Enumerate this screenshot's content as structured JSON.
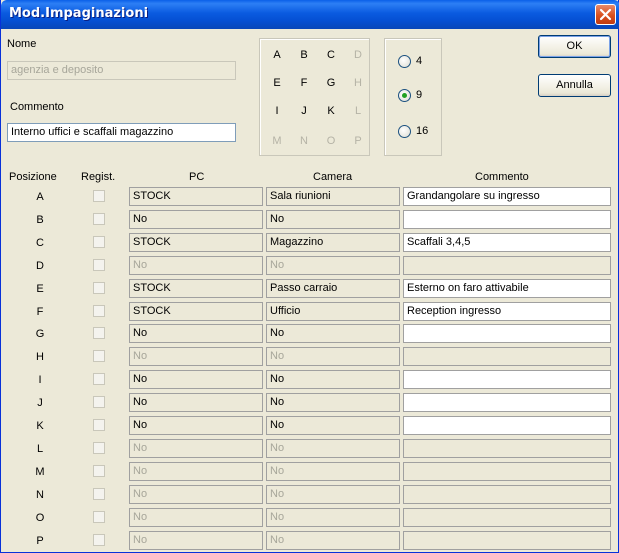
{
  "window": {
    "title": "Mod.Impaginazioni"
  },
  "form": {
    "nome_label": "Nome",
    "nome_value": "agenzia e deposito",
    "commento_label": "Commento",
    "commento_value": "Interno uffici e scaffali magazzino"
  },
  "grid_letters": [
    {
      "l": "A",
      "on": true
    },
    {
      "l": "B",
      "on": true
    },
    {
      "l": "C",
      "on": true
    },
    {
      "l": "D",
      "on": false
    },
    {
      "l": "E",
      "on": true
    },
    {
      "l": "F",
      "on": true
    },
    {
      "l": "G",
      "on": true
    },
    {
      "l": "H",
      "on": false
    },
    {
      "l": "I",
      "on": true
    },
    {
      "l": "J",
      "on": true
    },
    {
      "l": "K",
      "on": true
    },
    {
      "l": "L",
      "on": false
    },
    {
      "l": "M",
      "on": false
    },
    {
      "l": "N",
      "on": false
    },
    {
      "l": "O",
      "on": false
    },
    {
      "l": "P",
      "on": false
    }
  ],
  "layout_options": {
    "opt4": "4",
    "opt9": "9",
    "opt16": "16",
    "selected": "9"
  },
  "buttons": {
    "ok": "OK",
    "annulla": "Annulla"
  },
  "table": {
    "headers": {
      "posizione": "Posizione",
      "regist": "Regist.",
      "pc": "PC",
      "camera": "Camera",
      "commento": "Commento"
    },
    "rows": [
      {
        "pos": "A",
        "pc": "STOCK",
        "camera": "Sala riunioni",
        "comment": "Grandangolare su ingresso",
        "enabled": true
      },
      {
        "pos": "B",
        "pc": "No",
        "camera": "No",
        "comment": "",
        "enabled": true
      },
      {
        "pos": "C",
        "pc": "STOCK",
        "camera": "Magazzino",
        "comment": "Scaffali 3,4,5",
        "enabled": true
      },
      {
        "pos": "D",
        "pc": "No",
        "camera": "No",
        "comment": "",
        "enabled": false
      },
      {
        "pos": "E",
        "pc": "STOCK",
        "camera": "Passo carraio",
        "comment": "Esterno on faro attivabile",
        "enabled": true
      },
      {
        "pos": "F",
        "pc": "STOCK",
        "camera": "Ufficio",
        "comment": "Reception ingresso",
        "enabled": true
      },
      {
        "pos": "G",
        "pc": "No",
        "camera": "No",
        "comment": "",
        "enabled": true
      },
      {
        "pos": "H",
        "pc": "No",
        "camera": "No",
        "comment": "",
        "enabled": false
      },
      {
        "pos": "I",
        "pc": "No",
        "camera": "No",
        "comment": "",
        "enabled": true
      },
      {
        "pos": "J",
        "pc": "No",
        "camera": "No",
        "comment": "",
        "enabled": true
      },
      {
        "pos": "K",
        "pc": "No",
        "camera": "No",
        "comment": "",
        "enabled": true
      },
      {
        "pos": "L",
        "pc": "No",
        "camera": "No",
        "comment": "",
        "enabled": false
      },
      {
        "pos": "M",
        "pc": "No",
        "camera": "No",
        "comment": "",
        "enabled": false
      },
      {
        "pos": "N",
        "pc": "No",
        "camera": "No",
        "comment": "",
        "enabled": false
      },
      {
        "pos": "O",
        "pc": "No",
        "camera": "No",
        "comment": "",
        "enabled": false
      },
      {
        "pos": "P",
        "pc": "No",
        "camera": "No",
        "comment": "",
        "enabled": false
      }
    ]
  }
}
